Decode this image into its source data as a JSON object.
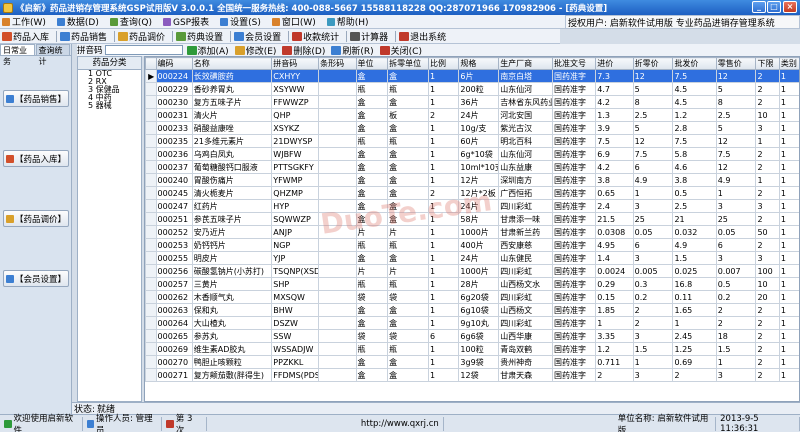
{
  "window": {
    "title": "《启新》药品进销存管理系统GSP试用版V 3.0.0.1 全国统一服务热线: 400-088-5667  15588118228  QQ:287071966 170982906 - [药典设置]",
    "controls": [
      "_",
      "□",
      "×"
    ],
    "colors": {
      "title_bg": "#1d5fc2",
      "selected_row": "#2f6fdf"
    }
  },
  "menu": {
    "items": [
      {
        "label": "工作(W)",
        "icon": "work-icon",
        "color": "#d9822b"
      },
      {
        "label": "数据(D)",
        "icon": "data-icon",
        "color": "#3c7fd2"
      },
      {
        "label": "查询(Q)",
        "icon": "query-icon",
        "color": "#5a9a3a"
      },
      {
        "label": "GSP报表",
        "icon": "report-icon",
        "color": "#8a5bbf"
      },
      {
        "label": "设置(S)",
        "icon": "settings-icon",
        "color": "#3c7fd2"
      },
      {
        "label": "窗口(W)",
        "icon": "window-icon",
        "color": "#d9822b"
      },
      {
        "label": "帮助(H)",
        "icon": "help-icon",
        "color": "#3c9ac0"
      }
    ],
    "auth_banner": "授权用户: 启新软件试用版  专业药品进销存管理系统"
  },
  "toolbar": {
    "buttons": [
      {
        "label": "药品入库",
        "icon": "stock-in-icon",
        "color": "#d2502b"
      },
      {
        "label": "药品销售",
        "icon": "sales-icon",
        "color": "#3c7fd2"
      },
      {
        "label": "药品调价",
        "icon": "price-adjust-icon",
        "color": "#d9a02b"
      },
      {
        "label": "药典设置",
        "icon": "pharmacopoeia-icon",
        "color": "#5a9a3a"
      },
      {
        "label": "会员设置",
        "icon": "member-icon",
        "color": "#3c7fd2"
      },
      {
        "label": "收款统计",
        "icon": "collection-icon",
        "color": "#c0392b"
      },
      {
        "label": "计算器",
        "icon": "calculator-icon",
        "color": "#555"
      },
      {
        "label": "退出系统",
        "icon": "exit-icon",
        "color": "#c0392b"
      }
    ]
  },
  "left": {
    "tabs": [
      "日常业务",
      "查询统计"
    ],
    "buttons": [
      "【药品销售】",
      "【药品入库】",
      "【药品调价】",
      "【会员设置】"
    ]
  },
  "tree": {
    "header": "药品分类",
    "items": [
      "1 OTC",
      "2 RX",
      "3 保健品",
      "4 中药",
      "5 器械"
    ]
  },
  "grid_toolbar": {
    "search_label": "拼音码",
    "search_value": "",
    "buttons": [
      {
        "label": "添加(A)",
        "icon": "add-icon",
        "color": "#2e9a3a"
      },
      {
        "label": "修改(E)",
        "icon": "edit-icon",
        "color": "#d9a02b"
      },
      {
        "label": "删除(D)",
        "icon": "delete-icon",
        "color": "#c0392b"
      },
      {
        "label": "刷新(R)",
        "icon": "refresh-icon",
        "color": "#3c7fd2"
      },
      {
        "label": "关闭(C)",
        "icon": "close-icon",
        "color": "#c0392b"
      }
    ]
  },
  "grid": {
    "columns": [
      "编码",
      "名称",
      "拼音码",
      "条形码",
      "单位",
      "拆零单位",
      "比例",
      "规格",
      "生产厂商",
      "批准文号",
      "进价",
      "折零价",
      "批发价",
      "零售价",
      "下限",
      "类别"
    ],
    "rows": [
      [
        "000224",
        "长效磺胺药",
        "CXHYY",
        "",
        "盒",
        "盒",
        "1",
        "6片",
        "南京白塔",
        "国药准字",
        "7.3",
        "12",
        "7.5",
        "12",
        "2",
        "1"
      ],
      [
        "000229",
        "香砂养胃丸",
        "XSYWW",
        "",
        "瓶",
        "瓶",
        "1",
        "200粒",
        "山东仙河",
        "国药准字",
        "4.7",
        "5",
        "4.5",
        "5",
        "2",
        "1"
      ],
      [
        "000230",
        "复方五味子片",
        "FFWWZP",
        "",
        "盒",
        "盒",
        "1",
        "36片",
        "吉林省东风药业",
        "国药准字",
        "4.2",
        "8",
        "4.5",
        "8",
        "2",
        "1"
      ],
      [
        "000231",
        "清火片",
        "QHP",
        "",
        "盒",
        "板",
        "2",
        "24片",
        "河北安国",
        "国药准字",
        "1.3",
        "2.5",
        "1.2",
        "2.5",
        "10",
        "1"
      ],
      [
        "000233",
        "硝酸益康唑",
        "XSYKZ",
        "",
        "盒",
        "盒",
        "1",
        "10g/支",
        "紫光古汉",
        "国药准字",
        "3.9",
        "5",
        "2.8",
        "5",
        "3",
        "1"
      ],
      [
        "000235",
        "21多维元素片",
        "21DWYSP",
        "",
        "瓶",
        "瓶",
        "1",
        "60片",
        "明北百科",
        "国药准字",
        "7.5",
        "12",
        "7.5",
        "12",
        "1",
        "1"
      ],
      [
        "000236",
        "乌鸡白凤丸",
        "WJBFW",
        "",
        "盒",
        "盒",
        "1",
        "6g*10袋",
        "山东仙河",
        "国药准字",
        "6.9",
        "7.5",
        "5.8",
        "7.5",
        "2",
        "1"
      ],
      [
        "000237",
        "葡萄糖酸钙口服液",
        "PTTSGKFY",
        "",
        "盒",
        "盒",
        "1",
        "10ml*10支",
        "山东益康",
        "国药准字",
        "4.2",
        "6",
        "4.6",
        "12",
        "2",
        "1"
      ],
      [
        "000240",
        "胃酸伤痛片",
        "YFWMP",
        "",
        "盒",
        "盒",
        "1",
        "12片",
        "深圳南方",
        "国药准字",
        "3.8",
        "4.9",
        "3.8",
        "4.9",
        "1",
        "1"
      ],
      [
        "000245",
        "清火栀麦片",
        "QHZMP",
        "",
        "盒",
        "盒",
        "2",
        "12片*2板",
        "广西恒拓",
        "国药准字",
        "0.65",
        "1",
        "0.5",
        "1",
        "2",
        "1"
      ],
      [
        "000247",
        "红药片",
        "HYP",
        "",
        "盒",
        "盒",
        "1",
        "24片",
        "四川彩虹",
        "国药准字",
        "2.4",
        "3",
        "2.5",
        "3",
        "3",
        "1"
      ],
      [
        "000251",
        "参芪五味子片",
        "SQWWZP",
        "",
        "盒",
        "盒",
        "1",
        "58片",
        "甘肃添一味",
        "国药准字",
        "21.5",
        "25",
        "21",
        "25",
        "2",
        "1"
      ],
      [
        "000252",
        "安乃近片",
        "ANJP",
        "",
        "片",
        "片",
        "1",
        "1000片",
        "甘肃新兰药",
        "国药准字",
        "0.0308",
        "0.05",
        "0.032",
        "0.05",
        "50",
        "1"
      ],
      [
        "000253",
        "奶钙钙片",
        "NGP",
        "",
        "瓶",
        "瓶",
        "1",
        "400片",
        "西安康慈",
        "国药准字",
        "4.95",
        "6",
        "4.9",
        "6",
        "2",
        "1"
      ],
      [
        "000255",
        "明皮片",
        "YJP",
        "",
        "盒",
        "盒",
        "1",
        "24片",
        "山东健民",
        "国药准字",
        "1.4",
        "3",
        "1.5",
        "3",
        "3",
        "1"
      ],
      [
        "000256",
        "碳酸氢钠片(小苏打)",
        "TSQNP(XSD)",
        "",
        "片",
        "片",
        "1",
        "1000片",
        "四川彩虹",
        "国药准字",
        "0.0024",
        "0.005",
        "0.025",
        "0.007",
        "100",
        "1"
      ],
      [
        "000257",
        "三黄片",
        "SHP",
        "",
        "瓶",
        "瓶",
        "1",
        "28片",
        "山西杨文水",
        "国药准字",
        "0.29",
        "0.3",
        "16.8",
        "0.5",
        "10",
        "1"
      ],
      [
        "000262",
        "木香顺气丸",
        "MXSQW",
        "",
        "袋",
        "袋",
        "1",
        "6g20袋",
        "四川彩虹",
        "国药准字",
        "0.15",
        "0.2",
        "0.11",
        "0.2",
        "20",
        "1"
      ],
      [
        "000263",
        "保和丸",
        "BHW",
        "",
        "盒",
        "盒",
        "1",
        "6g10袋",
        "山西杨文",
        "国药准字",
        "1.85",
        "2",
        "1.65",
        "2",
        "2",
        "1"
      ],
      [
        "000264",
        "大山楂丸",
        "DSZW",
        "",
        "盒",
        "盒",
        "1",
        "9g10丸",
        "四川彩虹",
        "国药准字",
        "1",
        "2",
        "1",
        "2",
        "2",
        "1"
      ],
      [
        "000265",
        "参苏丸",
        "SSW",
        "",
        "袋",
        "袋",
        "6",
        "6g6袋",
        "山西华康",
        "国药准字",
        "3.35",
        "3",
        "2.45",
        "18",
        "2",
        "1"
      ],
      [
        "000269",
        "维生素AD胶丸",
        "WSSADJW",
        "",
        "瓶",
        "瓶",
        "1",
        "100粒",
        "青岛双鹤",
        "国药准字",
        "1.2",
        "1.5",
        "1.25",
        "1.5",
        "2",
        "1"
      ],
      [
        "000270",
        "鸭胆止咳颗粒",
        "PPZKKL",
        "",
        "盒",
        "盒",
        "1",
        "3g9袋",
        "贵州神奇",
        "国药准字",
        "0.711",
        "1",
        "0.69",
        "1",
        "2",
        "1"
      ],
      [
        "000271",
        "复方颠茄敷(胖得生)",
        "FFDMS(PDS)",
        "",
        "盒",
        "盒",
        "1",
        "12袋",
        "甘肃天森",
        "国药准字",
        "2",
        "3",
        "2",
        "3",
        "2",
        "1"
      ]
    ],
    "selected_row": 0
  },
  "status": {
    "label": "状态:",
    "value": "就绪"
  },
  "footer": {
    "welcome": "欢迎使用启新软件",
    "operator": "操作人员: 管理员",
    "count": "第 3 次",
    "website": "http://www.qxrj.cn",
    "unit": "单位名称: 启新软件试用版",
    "datetime": "2013-9-5 11:36:31"
  },
  "watermark": "DuoTe.com"
}
